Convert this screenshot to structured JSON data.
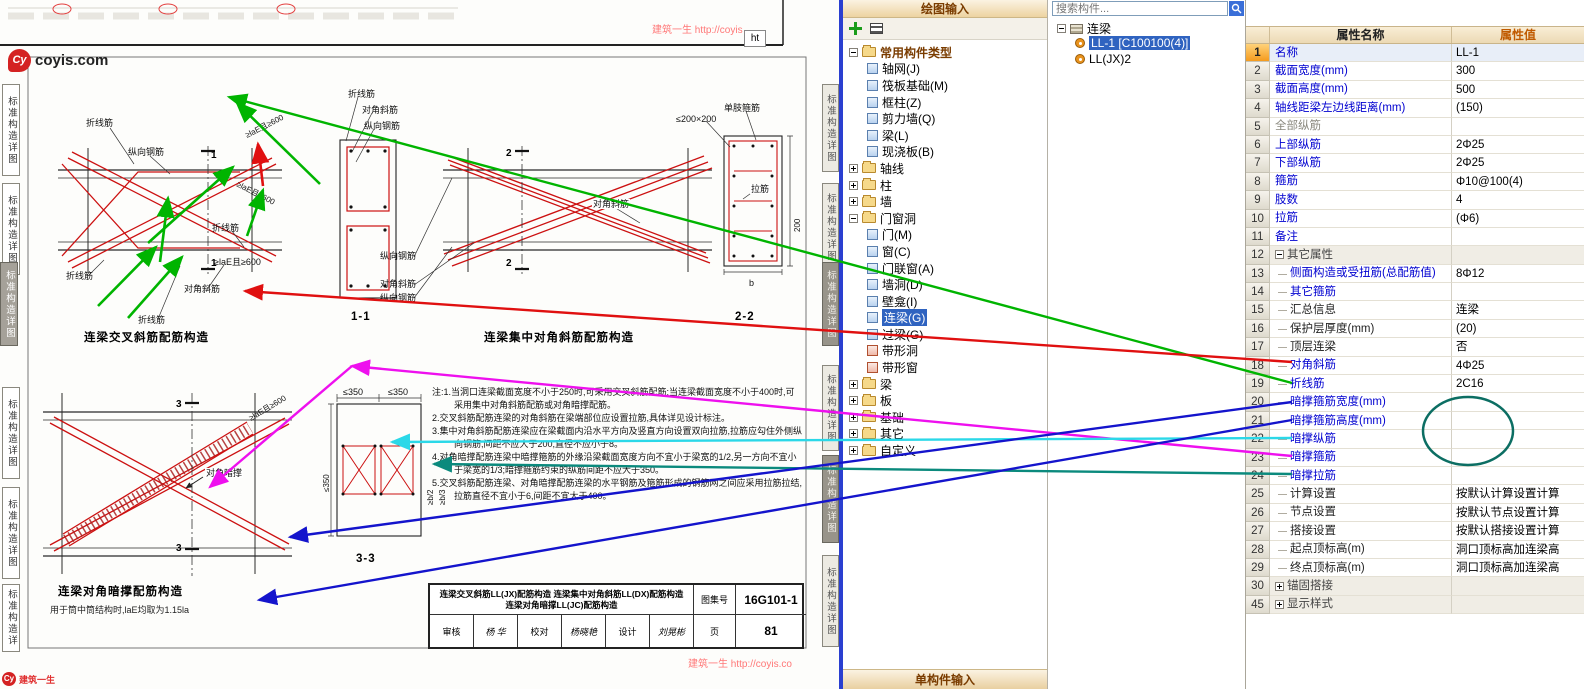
{
  "document": {
    "watermark_top": "建筑一生 http://coyis",
    "watermark_bottom": "建筑一生 http://coyis.co",
    "logo_brand": "coyis.com",
    "logo_mark": "Cy",
    "logo_tagline": "建筑一生",
    "snippet_ht": "ht",
    "side_tab": "标准构造详图",
    "labels": {
      "zhexianjin": "折线筋",
      "zongxiang": "纵向钢筋",
      "duijiao_xiejin": "对角斜筋",
      "duijiao_ancheng": "对角暗撑",
      "danzhi_gujin": "单肢箍筋",
      "lajin": "拉筋",
      "le200": "≤200×200",
      "dim600": "≥laE且≥600",
      "dim350": "≤350",
      "dim200": "200",
      "dimb": "b",
      "dimb2": "≥b/2",
      "dimb3": "≥b/3",
      "sec1": "1",
      "sec2": "2",
      "sec3": "3",
      "s11": "1-1",
      "s22": "2-2",
      "s33": "3-3"
    },
    "titles": {
      "d1": "连梁交叉斜筋配筋构造",
      "d2": "连梁集中对角斜筋配筋构造",
      "d3": "连梁对角暗撑配筋构造",
      "d3_note": "用于筒中筒结构时,laE均取为1.15la"
    },
    "notes": [
      "注:1.当洞口连梁截面宽度不小于250时,可采用交叉斜筋配筋;当连梁截面宽度不小于400时,可采用集中对角斜筋配筋或对角暗撑配筋。",
      "2.交叉斜筋配筋连梁的对角斜筋在梁端部位应设置拉筋,具体详见设计标注。",
      "3.集中对角斜筋配筋连梁应在梁截面内沿水平方向及竖直方向设置双向拉筋,拉筋应勾住外侧纵向钢筋,间距不应大于200,直径不应小于8。",
      "4.对角暗撑配筋连梁中暗撑箍筋的外缘沿梁截面宽度方向不宜小于梁宽的1/2,另一方向不宜小于梁宽的1/3;暗撑箍筋约束的纵筋间距不应大于350。",
      "5.交叉斜筋配筋连梁、对角暗撑配筋连梁的水平钢筋及箍筋形成的钢筋网之间应采用拉筋拉结,拉筋直径不宜小于6,间距不宜大于400。"
    ],
    "titleblock": {
      "line1": "连梁交叉斜筋LL(JX)配筋构造  连梁集中对角斜筋LL(DX)配筋构造",
      "line2": "连梁对角暗撑LL(JC)配筋构造",
      "atlas_label": "图集号",
      "atlas_no": "16G101-1",
      "review_label": "审核",
      "review_name": "杨 华",
      "check_label": "校对",
      "check_name": "杨晓艳",
      "design_label": "设计",
      "design_name": "刘晃彬",
      "page_label": "页",
      "page_no": "81"
    }
  },
  "draw_panel": {
    "title": "绘图输入",
    "bottom_bar": "单构件输入",
    "tree": [
      {
        "label": "常用构件类型"
      },
      {
        "label": "轴网(J)"
      },
      {
        "label": "筏板基础(M)"
      },
      {
        "label": "框柱(Z)"
      },
      {
        "label": "剪力墙(Q)"
      },
      {
        "label": "梁(L)"
      },
      {
        "label": "现浇板(B)"
      },
      {
        "label": "轴线"
      },
      {
        "label": "柱"
      },
      {
        "label": "墙"
      },
      {
        "label": "门窗洞"
      },
      {
        "label": "门(M)"
      },
      {
        "label": "窗(C)"
      },
      {
        "label": "门联窗(A)"
      },
      {
        "label": "墙洞(D)"
      },
      {
        "label": "壁龛(I)"
      },
      {
        "label": "连梁(G)"
      },
      {
        "label": "过梁(G)"
      },
      {
        "label": "带形洞"
      },
      {
        "label": "带形窗"
      },
      {
        "label": "梁"
      },
      {
        "label": "板"
      },
      {
        "label": "基础"
      },
      {
        "label": "其它"
      },
      {
        "label": "自定义"
      }
    ]
  },
  "comp_panel": {
    "search_placeholder": "搜索构件...",
    "root": "连梁",
    "items": [
      "LL-1 [C100100(4)]",
      "LL(JX)2"
    ]
  },
  "props": {
    "header_name": "属性名称",
    "header_value": "属性值",
    "rows": [
      {
        "no": "1",
        "name": "名称",
        "value": "LL-1"
      },
      {
        "no": "2",
        "name": "截面宽度(mm)",
        "value": "300"
      },
      {
        "no": "3",
        "name": "截面高度(mm)",
        "value": "500"
      },
      {
        "no": "4",
        "name": "轴线距梁左边线距离(mm)",
        "value": "(150)"
      },
      {
        "no": "5",
        "name": "全部纵筋",
        "value": ""
      },
      {
        "no": "6",
        "name": "上部纵筋",
        "value": "2Φ25"
      },
      {
        "no": "7",
        "name": "下部纵筋",
        "value": "2Φ25"
      },
      {
        "no": "8",
        "name": "箍筋",
        "value": "Φ10@100(4)"
      },
      {
        "no": "9",
        "name": "肢数",
        "value": "4"
      },
      {
        "no": "10",
        "name": "拉筋",
        "value": "(Φ6)"
      },
      {
        "no": "11",
        "name": "备注",
        "value": ""
      },
      {
        "no": "12",
        "name": "其它属性",
        "value": ""
      },
      {
        "no": "13",
        "name": "侧面构造或受扭筋(总配筋值)",
        "value": "8Φ12"
      },
      {
        "no": "14",
        "name": "其它箍筋",
        "value": ""
      },
      {
        "no": "15",
        "name": "汇总信息",
        "value": "连梁"
      },
      {
        "no": "16",
        "name": "保护层厚度(mm)",
        "value": "(20)"
      },
      {
        "no": "17",
        "name": "顶层连梁",
        "value": "否"
      },
      {
        "no": "18",
        "name": "对角斜筋",
        "value": "4Φ25"
      },
      {
        "no": "19",
        "name": "折线筋",
        "value": "2C16"
      },
      {
        "no": "20",
        "name": "暗撑箍筋宽度(mm)",
        "value": ""
      },
      {
        "no": "21",
        "name": "暗撑箍筋高度(mm)",
        "value": ""
      },
      {
        "no": "22",
        "name": "暗撑纵筋",
        "value": ""
      },
      {
        "no": "23",
        "name": "暗撑箍筋",
        "value": ""
      },
      {
        "no": "24",
        "name": "暗撑拉筋",
        "value": ""
      },
      {
        "no": "25",
        "name": "计算设置",
        "value": "按默认计算设置计算"
      },
      {
        "no": "26",
        "name": "节点设置",
        "value": "按默认节点设置计算"
      },
      {
        "no": "27",
        "name": "搭接设置",
        "value": "按默认搭接设置计算"
      },
      {
        "no": "28",
        "name": "起点顶标高(m)",
        "value": "洞口顶标高加连梁高"
      },
      {
        "no": "29",
        "name": "终点顶标高(m)",
        "value": "洞口顶标高加连梁高"
      },
      {
        "no": "30",
        "name": "锚固搭接",
        "value": ""
      },
      {
        "no": "45",
        "name": "显示样式",
        "value": ""
      }
    ]
  },
  "annotations": {
    "arrow_colors": {
      "green": "#00b400",
      "red": "#e01010",
      "magenta": "#ee10ee",
      "cyan": "#2bd8e8",
      "teal": "#0b8a7d",
      "blue": "#1414cc",
      "ellipse": "#0c6e63"
    }
  }
}
